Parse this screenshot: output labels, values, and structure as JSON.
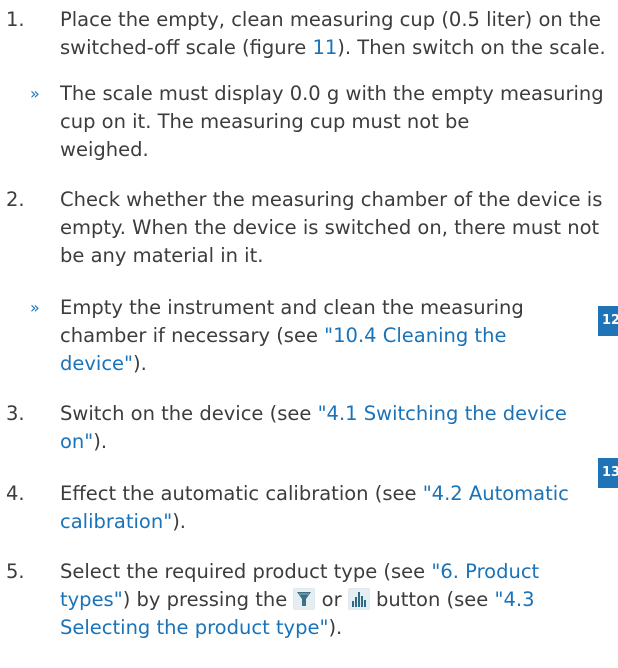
{
  "steps": [
    {
      "num": "1.",
      "lines": [
        [
          "Place the empty, clean measuring cup (0.5 liter) on the",
          ""
        ],
        [
          "switched-off scale (figure ",
          "11",
          "). Then switch on the scale."
        ]
      ]
    },
    {
      "num": "»",
      "lines": [
        [
          "The scale must display 0.0 g with the empty measuring"
        ],
        [
          "cup on it. The measuring cup must not be"
        ],
        [
          "weighed."
        ]
      ]
    },
    {
      "num": "2.",
      "lines": [
        [
          "Check whether the measuring chamber of the device is"
        ],
        [
          "empty. When the device is switched on, there must not"
        ],
        [
          "be any material in it."
        ]
      ]
    },
    {
      "num": "»",
      "lines": [
        [
          "Empty the instrument and clean the measuring"
        ],
        [
          "chamber if necessary (see ",
          "\"10.4 Cleaning the"
        ],
        [
          "",
          "device\"",
          ")."
        ]
      ]
    },
    {
      "num": "3.",
      "lines": [
        [
          "Switch on the device (see ",
          "\"4.1 Switching the device"
        ],
        [
          "",
          "on\"",
          ")."
        ]
      ]
    },
    {
      "num": "4.",
      "lines": [
        [
          "Effect the automatic calibration (see ",
          "\"4.2 Automatic"
        ],
        [
          "",
          "calibration\"",
          ")."
        ]
      ]
    },
    {
      "num": "5.",
      "lines": [
        [
          "Select the required product type (see ",
          "\"6. Product"
        ],
        [
          "",
          "types\"",
          ") by pressing the ",
          "[icon1]",
          " or ",
          "[icon2]",
          " button (see ",
          "\"4.3"
        ],
        [
          "",
          "Selecting the product type\"",
          ")."
        ]
      ]
    }
  ],
  "markers": [
    "12",
    "13"
  ],
  "icons": {
    "funnel": "funnel-filter-icon",
    "bars": "bar-chart-icon"
  },
  "colors": {
    "text": "#3c3c3c",
    "link": "#1a73b8",
    "marker": "#1f74b8"
  }
}
